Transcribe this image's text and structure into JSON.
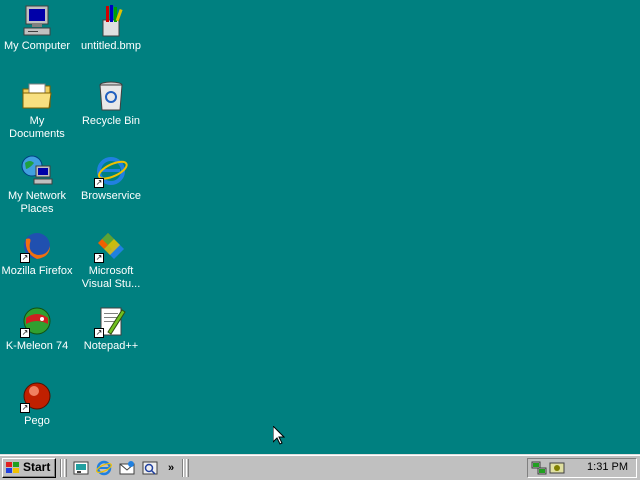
{
  "desktop": {
    "icons": [
      {
        "label": "My Computer"
      },
      {
        "label": "untitled.bmp"
      },
      {
        "label": "My Documents"
      },
      {
        "label": "Recycle Bin"
      },
      {
        "label": "My Network Places"
      },
      {
        "label": "Browservice"
      },
      {
        "label": "Mozilla Firefox"
      },
      {
        "label": "Microsoft Visual Stu..."
      },
      {
        "label": "K-Meleon 74"
      },
      {
        "label": "Notepad++"
      },
      {
        "label": "Pego"
      }
    ]
  },
  "taskbar": {
    "start_label": "Start",
    "quick_launch": [
      "show-desktop-icon",
      "internet-explorer-icon",
      "outlook-express-icon",
      "windows-media-icon"
    ],
    "overflow": "»",
    "tray": {
      "clock": "1:31 PM"
    }
  },
  "colors": {
    "desktop": "#008080",
    "taskbar": "#c0c0c0"
  }
}
